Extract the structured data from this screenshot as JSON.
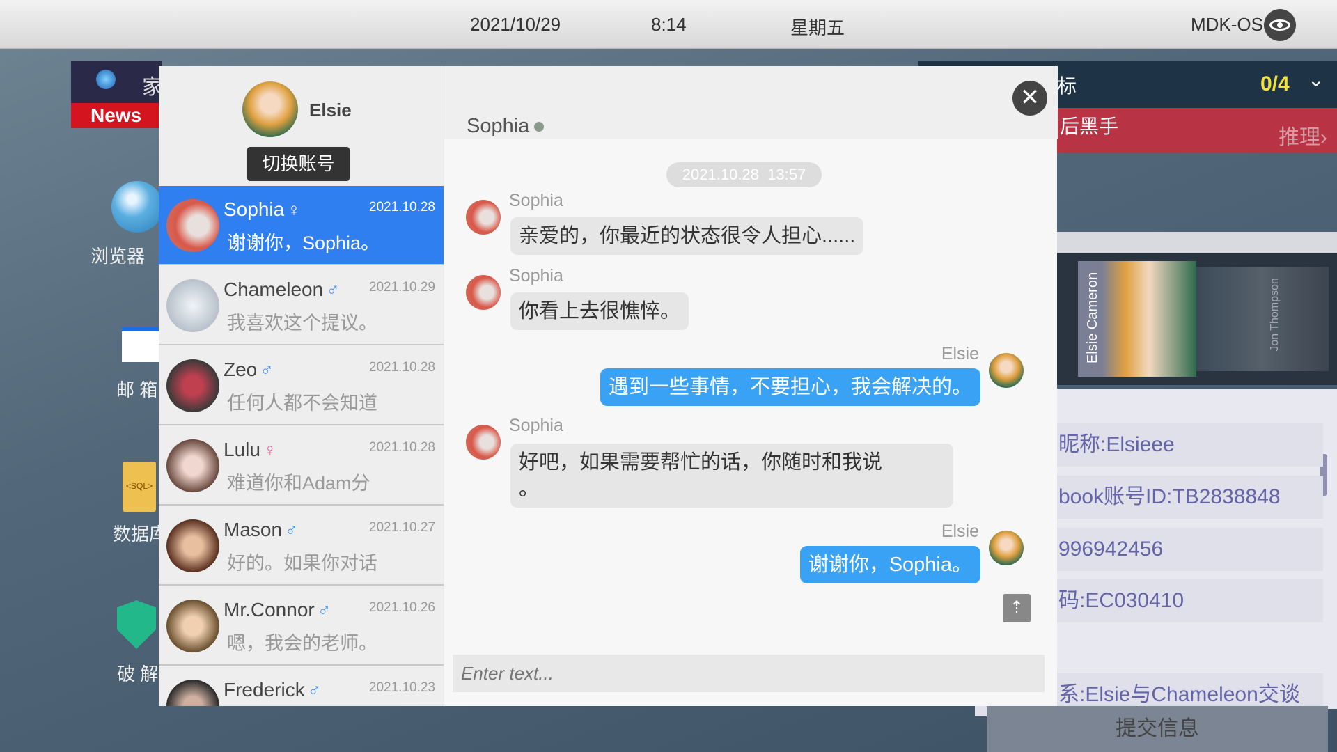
{
  "topbar": {
    "date": "2021/10/29",
    "time": "8:14",
    "weekday": "星期五",
    "os": "MDK-OS"
  },
  "desktop": {
    "news_label": "News",
    "news_title": "家",
    "icons": [
      {
        "label": "浏览器",
        "icon": "globe-icon"
      },
      {
        "label": "邮 箱",
        "icon": "mail-icon"
      },
      {
        "label": "数据库",
        "icon": "sql-file-icon"
      },
      {
        "label": "破 解",
        "icon": "shield-key-icon"
      }
    ]
  },
  "right_panel": {
    "header": "标",
    "progress": "0/4",
    "task": "后黑手",
    "reason_button": "推理›",
    "portraits": [
      "Elsie Cameron",
      "Jon Thompson"
    ],
    "info": [
      "昵称:Elsieee",
      "book账号ID:TB2838848",
      "996942456",
      "码:EC030410",
      "系:Elsie与Chameleon交谈"
    ],
    "submit": "提交信息"
  },
  "account": {
    "name": "Elsie",
    "switch_label": "切换账号"
  },
  "contacts": [
    {
      "name": "Sophia",
      "gender": "♀",
      "date": "2021.10.28",
      "preview": "谢谢你，Sophia。",
      "selected": true
    },
    {
      "name": "Chameleon",
      "gender": "♂",
      "date": "2021.10.29",
      "preview": "我喜欢这个提议。"
    },
    {
      "name": "Zeo",
      "gender": "♂",
      "date": "2021.10.28",
      "preview": "任何人都不会知道"
    },
    {
      "name": "Lulu",
      "gender": "♀",
      "date": "2021.10.28",
      "preview": "难道你和Adam分"
    },
    {
      "name": "Mason",
      "gender": "♂",
      "date": "2021.10.27",
      "preview": "好的。如果你对话"
    },
    {
      "name": "Mr.Connor",
      "gender": "♂",
      "date": "2021.10.26",
      "preview": "嗯，我会的老师。"
    },
    {
      "name": "Frederick",
      "gender": "♂",
      "date": "2021.10.23",
      "preview": ""
    }
  ],
  "chat": {
    "title": "Sophia",
    "timestamp": "2021.10.28  13:57",
    "messages": [
      {
        "sender": "Sophia",
        "text": "亲爱的，你最近的状态很令人担心......"
      },
      {
        "sender": "Sophia",
        "text": "你看上去很憔悴。"
      },
      {
        "sender": "Elsie",
        "text": "遇到一些事情，不要担心，我会解决的。"
      },
      {
        "sender": "Sophia",
        "text": "好吧，如果需要帮忙的话，你随时和我说\n。"
      },
      {
        "sender": "Elsie",
        "text": "谢谢你，Sophia。"
      }
    ],
    "input_placeholder": "Enter text..."
  },
  "colors": {
    "selected": "#2f7ff0",
    "my_bubble": "#3aa2f5",
    "male": "#3b8ff0",
    "female": "#f0609a"
  }
}
